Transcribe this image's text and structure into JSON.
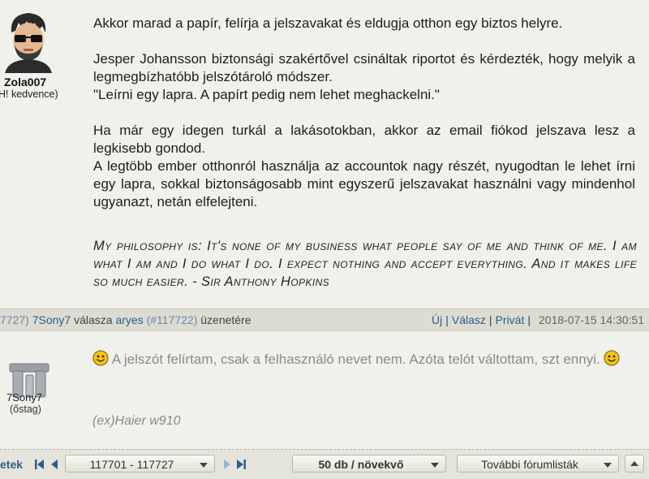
{
  "post1": {
    "author": "Zola007",
    "rank": "H! kedvence)",
    "paragraphs": [
      "Akkor marad a papír, felírja a jelszavakat és eldugja otthon egy biztos helyre.",
      "Jesper Johansson biztonsági szakértővel csináltak riportot és kérdezték, hogy melyik a legmegbízhatóbb jelszótároló módszer.",
      "\"Leírni egy lapra. A papírt pedig nem lehet meghackelni.\"",
      "Ha már egy idegen turkál a lakásotokban, akkor az email fiókod jelszava lesz a legkisebb gondod.",
      "A legtöbb ember otthonról használja az accountok nagy részét, nyugodtan le lehet írni egy lapra, sokkal biztonságosabb mint egyszerű jelszavakat használni vagy mindenhol ugyanazt, netán elfelejteni."
    ],
    "signature": "My philosophy is: It's none of my business what people say of me and think of me. I am what I am and I do what I do. I expect nothing and accept everything. And it makes life so much easier. - Sir Anthony Hopkins"
  },
  "reply_bar": {
    "prefix_id": "7727)",
    "author": "7Sony7",
    "reply_word": "válasza",
    "target_user": "aryes",
    "target_id": "(#117722)",
    "suffix": "üzenetére",
    "actions": [
      "Új",
      "Válasz",
      "Privát"
    ],
    "datetime": "2018-07-15 14:30:51"
  },
  "post2": {
    "author": "7Sony7",
    "rank": "(őstag)",
    "text_a": " A jelszót felírtam, csak a felhasználó nevet nem. Azóta telót váltottam, szt ennyi. ",
    "signature": "(ex)Haier w910"
  },
  "toolbar": {
    "label": "etek",
    "range_select": "117701 - 117727",
    "sort_select": "50 db / növekvő",
    "more_select": "További fórumlisták"
  },
  "colors": {
    "link": "#2f5d8a",
    "bar_bg": "#dcdcd2",
    "smiley": "#f2c318"
  }
}
